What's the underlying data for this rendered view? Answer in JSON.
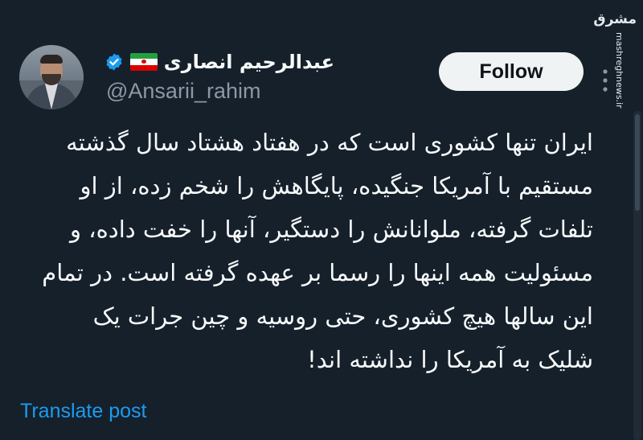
{
  "author": {
    "display_name": "عبدالرحیم انصاری",
    "handle": "@Ansarii_rahim",
    "flag": "Iran flag",
    "verified": true,
    "verified_color": "#1d9bf0"
  },
  "actions": {
    "follow_label": "Follow",
    "more_icon": "more-vertical-icon"
  },
  "tweet": {
    "lines": [
      "ایران تنها کشوری است که در هفتاد هشتاد سال گذشته",
      "مستقیم با آمریکا جنگیده، پایگاهش را شخم زده، از او",
      "تلفات گرفته، ملوانانش را دستگیر، آنها را خفت داده، و",
      "مسئولیت همه اینها را رسما بر عهده گرفته است. در تمام",
      "این سالها هیچ کشوری، حتی روسیه و چین جرات یک",
      "شلیک به آمریکا را نداشته اند!"
    ],
    "translate_label": "Translate post"
  },
  "watermark": {
    "logo_text": "مشرق",
    "url": "mashreghnews.ir"
  },
  "colors": {
    "background": "#15202b",
    "text": "#f7f9f9",
    "secondary_text": "#8b98a5",
    "link": "#1d9bf0",
    "button_bg": "#eff3f4"
  }
}
